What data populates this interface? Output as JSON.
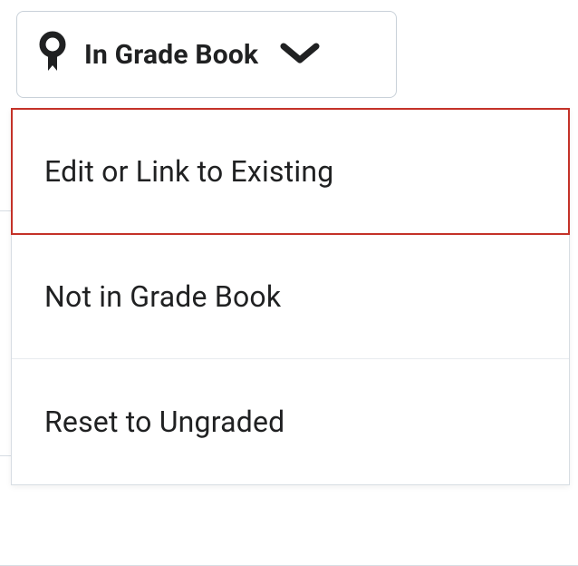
{
  "dropdown": {
    "button_label": "In Grade Book",
    "items": [
      {
        "label": "Edit or Link to Existing",
        "highlighted": true
      },
      {
        "label": "Not in Grade Book",
        "highlighted": false
      },
      {
        "label": "Reset to Ungraded",
        "highlighted": false
      }
    ]
  }
}
